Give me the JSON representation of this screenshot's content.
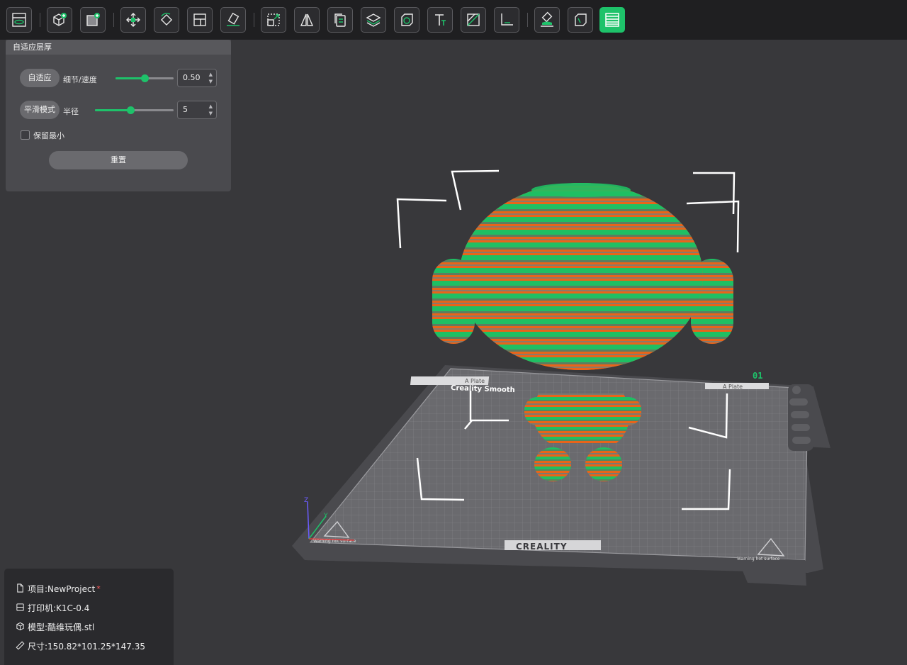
{
  "toolbar": {
    "buttons": [
      {
        "id": "view",
        "icon": "preview-icon"
      },
      {
        "id": "open",
        "icon": "add-model-icon"
      },
      {
        "id": "add",
        "icon": "add-plate-icon"
      },
      {
        "id": "move",
        "icon": "move-icon"
      },
      {
        "id": "rotate",
        "icon": "rotate-icon"
      },
      {
        "id": "arrange",
        "icon": "arrange-icon"
      },
      {
        "id": "place",
        "icon": "lay-flat-icon"
      },
      {
        "id": "scale",
        "icon": "scale-icon"
      },
      {
        "id": "mirror",
        "icon": "mirror-icon"
      },
      {
        "id": "clone",
        "icon": "clone-icon"
      },
      {
        "id": "layers",
        "icon": "layers-icon"
      },
      {
        "id": "hollow",
        "icon": "hollow-icon"
      },
      {
        "id": "text",
        "icon": "text-icon"
      },
      {
        "id": "cut",
        "icon": "cut-icon"
      },
      {
        "id": "measure",
        "icon": "measure-icon"
      },
      {
        "id": "paint",
        "icon": "paint-icon"
      },
      {
        "id": "support",
        "icon": "support-icon"
      },
      {
        "id": "adaptive-layer",
        "icon": "adaptive-layer-icon",
        "active": true
      }
    ]
  },
  "panel": {
    "title": "自适应层厚",
    "adaptive_button": "自适应",
    "detail_label": "细节/速度",
    "detail_value": "0.50",
    "detail_fraction": 0.5,
    "smooth_button": "平滑模式",
    "radius_label": "半径",
    "radius_value": "5",
    "radius_fraction": 0.45,
    "keep_min_label": "保留最小",
    "keep_min_checked": false,
    "reset_button": "重置"
  },
  "plate": {
    "badge": "01",
    "brand": "CREALITY",
    "top_label": "Creality Smooth",
    "left_label_1": "A Plate",
    "right_label": "A Plate",
    "warning": "Warning hot surface"
  },
  "info": {
    "project_label": "项目:NewProject",
    "modified_mark": "*",
    "printer_label": "打印机:K1C-0.4",
    "model_label": "模型:酷维玩偶.stl",
    "size_label": "尺寸:150.82*101.25*147.35"
  },
  "colors": {
    "accent": "#1ec26a",
    "model_orange": "#e8641a",
    "model_green": "#1fbf63",
    "background": "#38383b"
  }
}
